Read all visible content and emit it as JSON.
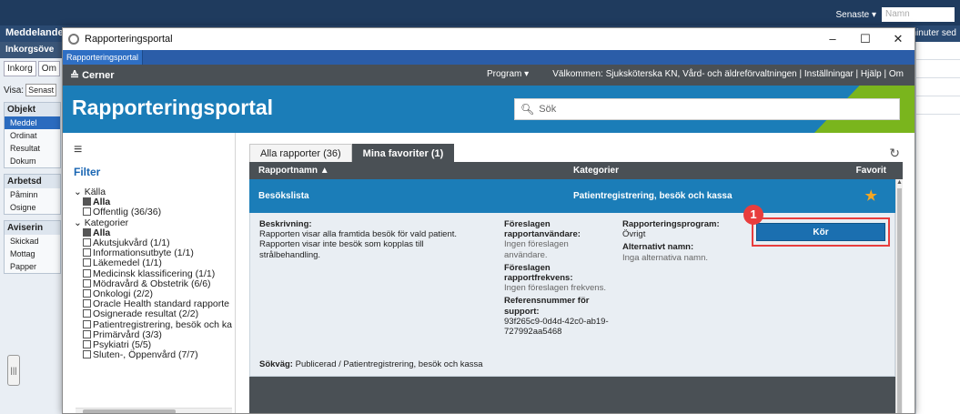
{
  "background_app": {
    "title": "Meddelande",
    "inbox_header": "Inkorgsöve",
    "tabs": [
      "Inkorg",
      "Om"
    ],
    "visa_label": "Visa:",
    "visa_value": "Senast",
    "groups": [
      {
        "header": "Objekt",
        "items": [
          "Meddel",
          "Ordinat",
          "Resultat",
          "Dokum"
        ]
      },
      {
        "header": "Arbetsd",
        "items": [
          "Påminn",
          "Osigne"
        ]
      },
      {
        "header": "Aviserin",
        "items": [
          "Skickad",
          "Mottag",
          "Papper"
        ]
      }
    ],
    "top_right_recent": "Senaste",
    "top_right_name_placeholder": "Namn",
    "update_text": "1 minuter sed"
  },
  "window": {
    "title": "Rapporteringsportal",
    "tab_label": "Rapporteringsportal",
    "controls": [
      "–",
      "☐",
      "✕"
    ]
  },
  "header": {
    "brand": "Cerner",
    "program_menu": "Program",
    "welcome": "Välkommen: Sjuksköterska KN, Vård- och äldreförvaltningen  |  Inställningar  |  Hjälp  |  Om",
    "portal_title": "Rapporteringsportal",
    "search_placeholder": "Sök"
  },
  "sidebar": {
    "filter_title": "Filter",
    "sections": [
      {
        "label": "Källa",
        "items": [
          {
            "label": "Alla",
            "checked": true
          },
          {
            "label": "Offentlig (36/36)",
            "checked": false
          }
        ]
      },
      {
        "label": "Kategorier",
        "items": [
          {
            "label": "Alla",
            "checked": true
          },
          {
            "label": "Akutsjukvård (1/1)",
            "checked": false
          },
          {
            "label": "Informationsutbyte (1/1)",
            "checked": false
          },
          {
            "label": "Läkemedel (1/1)",
            "checked": false
          },
          {
            "label": "Medicinsk klassificering (1/1)",
            "checked": false
          },
          {
            "label": "Mödravård & Obstetrik (6/6)",
            "checked": false
          },
          {
            "label": "Onkologi (2/2)",
            "checked": false
          },
          {
            "label": "Oracle Health standard rapporte",
            "checked": false
          },
          {
            "label": "Osignerade resultat (2/2)",
            "checked": false
          },
          {
            "label": "Patientregistrering, besök och ka",
            "checked": false
          },
          {
            "label": "Primärvård (3/3)",
            "checked": false
          },
          {
            "label": "Psykiatri (5/5)",
            "checked": false
          },
          {
            "label": "Sluten-, Öppenvård (7/7)",
            "checked": false
          }
        ]
      }
    ]
  },
  "main": {
    "tabs": [
      {
        "label": "Alla rapporter (36)",
        "active": false
      },
      {
        "label": "Mina favoriter (1)",
        "active": true
      }
    ],
    "columns": {
      "name": "Rapportnamn ▲",
      "category": "Kategorier",
      "favorite": "Favorit"
    },
    "selected_row": {
      "name": "Besökslista",
      "category": "Patientregistrering, besök och kassa"
    },
    "detail": {
      "description_label": "Beskrivning:",
      "description_text": "Rapporten visar alla framtida besök för vald patient. Rapporten visar inte besök som kopplas till strålbehandling.",
      "suggested_users_label": "Föreslagen rapportanvändare:",
      "suggested_users_value": "Ingen föreslagen användare.",
      "suggested_freq_label": "Föreslagen rapportfrekvens:",
      "suggested_freq_value": "Ingen föreslagen frekvens.",
      "ref_label": "Referensnummer för support:",
      "ref_value": "93f265c9-0d4d-42c0-ab19-727992aa5468",
      "program_label": "Rapporteringsprogram:",
      "program_value": "Övrigt",
      "alt_name_label": "Alternativt namn:",
      "alt_name_value": "Inga alternativa namn.",
      "run_button": "Kör",
      "step_badge": "1",
      "path_label": "Sökväg:",
      "path_value": "Publicerad / Patientregistrering, besök och kassa"
    }
  }
}
